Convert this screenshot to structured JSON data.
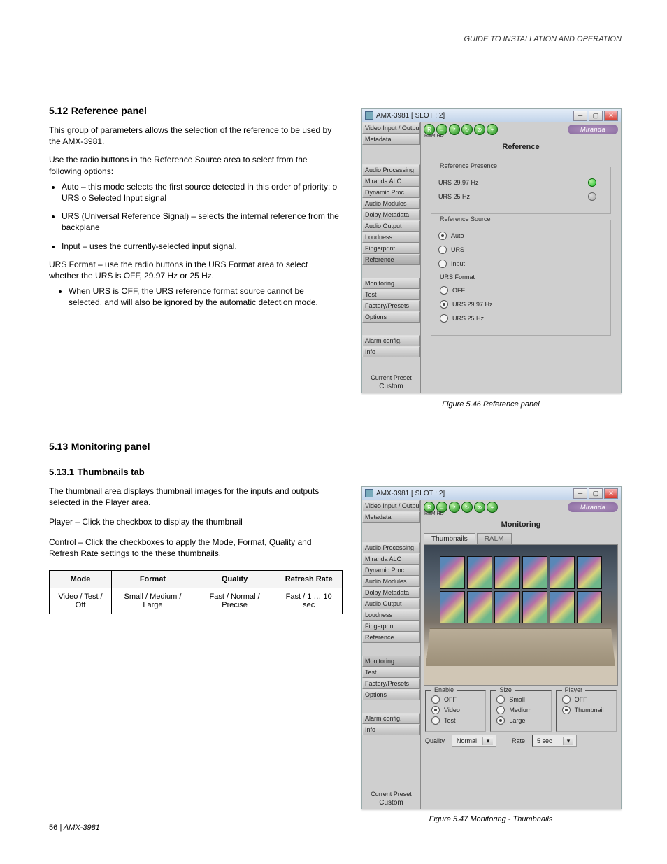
{
  "header": {
    "doc_title": "GUIDE TO INSTALLATION AND OPERATION"
  },
  "sections": {
    "s1": {
      "num": "5.12",
      "title": "Reference panel",
      "para1": "This group of parameters allows the selection of the reference to be used by the AMX-3981.",
      "para2": "Use the radio buttons in the Reference Source area to select from the following options:",
      "bullets": [
        "Auto – this mode selects the first source detected in this order of priority:\n o URS\n o Selected Input signal",
        "URS (Universal Reference Signal) – selects the internal reference from the backplane",
        "Input – uses the currently-selected input signal."
      ],
      "para3": "URS Format – use the radio buttons in the URS Format area to select whether the URS is OFF, 29.97 Hz or 25 Hz.",
      "bullet_last": "When URS is OFF, the URS reference format source cannot be selected, and will also be ignored by the automatic detection mode."
    },
    "s2": {
      "num": "5.13",
      "title": "Monitoring panel",
      "sub1_num": "5.13.1",
      "sub1_title": "Thumbnails tab",
      "para1": "The thumbnail area displays thumbnail images for the inputs and outputs selected in the Player area.",
      "para2_label": "Player – ",
      "para2_text": "Click the checkbox to display the thumbnail",
      "para3_label": "Control – ",
      "para3_text": "Click the checkboxes to apply the Mode, Format, Quality and Refresh Rate settings to the these thumbnails.",
      "table": {
        "headers": [
          "Mode",
          "Format",
          "Quality",
          "Refresh Rate"
        ],
        "row": [
          "Video / Test / Off",
          "Small / Medium / Large",
          "Fast / Normal / Precise",
          "Fast / 1 … 10 sec"
        ]
      }
    }
  },
  "captions": {
    "fig1": "Figure 5.46  Reference panel",
    "fig2": "Figure 5.47  Monitoring - Thumbnails"
  },
  "footer": {
    "pageline": "56",
    "separator": " | ",
    "product": "AMX-3981"
  },
  "win_common": {
    "title": "AMX-3981 [ SLOT : 2]",
    "brand": "Miranda",
    "icon_sub": "REM  HD",
    "icons": [
      "R",
      "→",
      "⏵",
      "↻",
      "⊛",
      "+"
    ],
    "sidebar": {
      "items": [
        "Video Input / Output",
        "Metadata",
        "Audio Processing",
        "Miranda ALC",
        "Dynamic Proc.",
        "Audio Modules",
        "Dolby Metadata",
        "Audio Output",
        "Loudness",
        "Fingerprint",
        "Reference",
        "Monitoring",
        "Test",
        "Factory/Presets",
        "Options",
        "Alarm config.",
        "Info"
      ],
      "current_preset_label": "Current Preset",
      "current_preset_value": "Custom"
    }
  },
  "win1": {
    "pane_title": "Reference",
    "presence": {
      "title": "Reference Presence",
      "rows": [
        {
          "label": "URS 29.97 Hz",
          "led": "green"
        },
        {
          "label": "URS 25 Hz",
          "led": "gray"
        }
      ]
    },
    "source": {
      "title": "Reference Source",
      "options": [
        {
          "label": "Auto",
          "checked": true
        },
        {
          "label": "URS",
          "checked": false
        },
        {
          "label": "Input",
          "checked": false
        }
      ],
      "urs_format": {
        "title": "URS Format",
        "options": [
          {
            "label": "OFF",
            "checked": false
          },
          {
            "label": "URS 29.97 Hz",
            "checked": true
          },
          {
            "label": "URS 25 Hz",
            "checked": false
          }
        ]
      }
    }
  },
  "win2": {
    "pane_title": "Monitoring",
    "tabs": [
      {
        "label": "Thumbnails",
        "active": true
      },
      {
        "label": "RALM",
        "active": false
      }
    ],
    "enable": {
      "title": "Enable",
      "options": [
        {
          "label": "OFF",
          "checked": false
        },
        {
          "label": "Video",
          "checked": true
        },
        {
          "label": "Test",
          "checked": false
        }
      ]
    },
    "size": {
      "title": "Size",
      "options": [
        {
          "label": "Small",
          "checked": false
        },
        {
          "label": "Medium",
          "checked": false
        },
        {
          "label": "Large",
          "checked": true
        }
      ]
    },
    "player": {
      "title": "Player",
      "options": [
        {
          "label": "OFF",
          "checked": false
        },
        {
          "label": "Thumbnail",
          "checked": true
        }
      ]
    },
    "quality": {
      "label": "Quality",
      "value": "Normal"
    },
    "rate": {
      "label": "Rate",
      "value": "5 sec"
    }
  }
}
